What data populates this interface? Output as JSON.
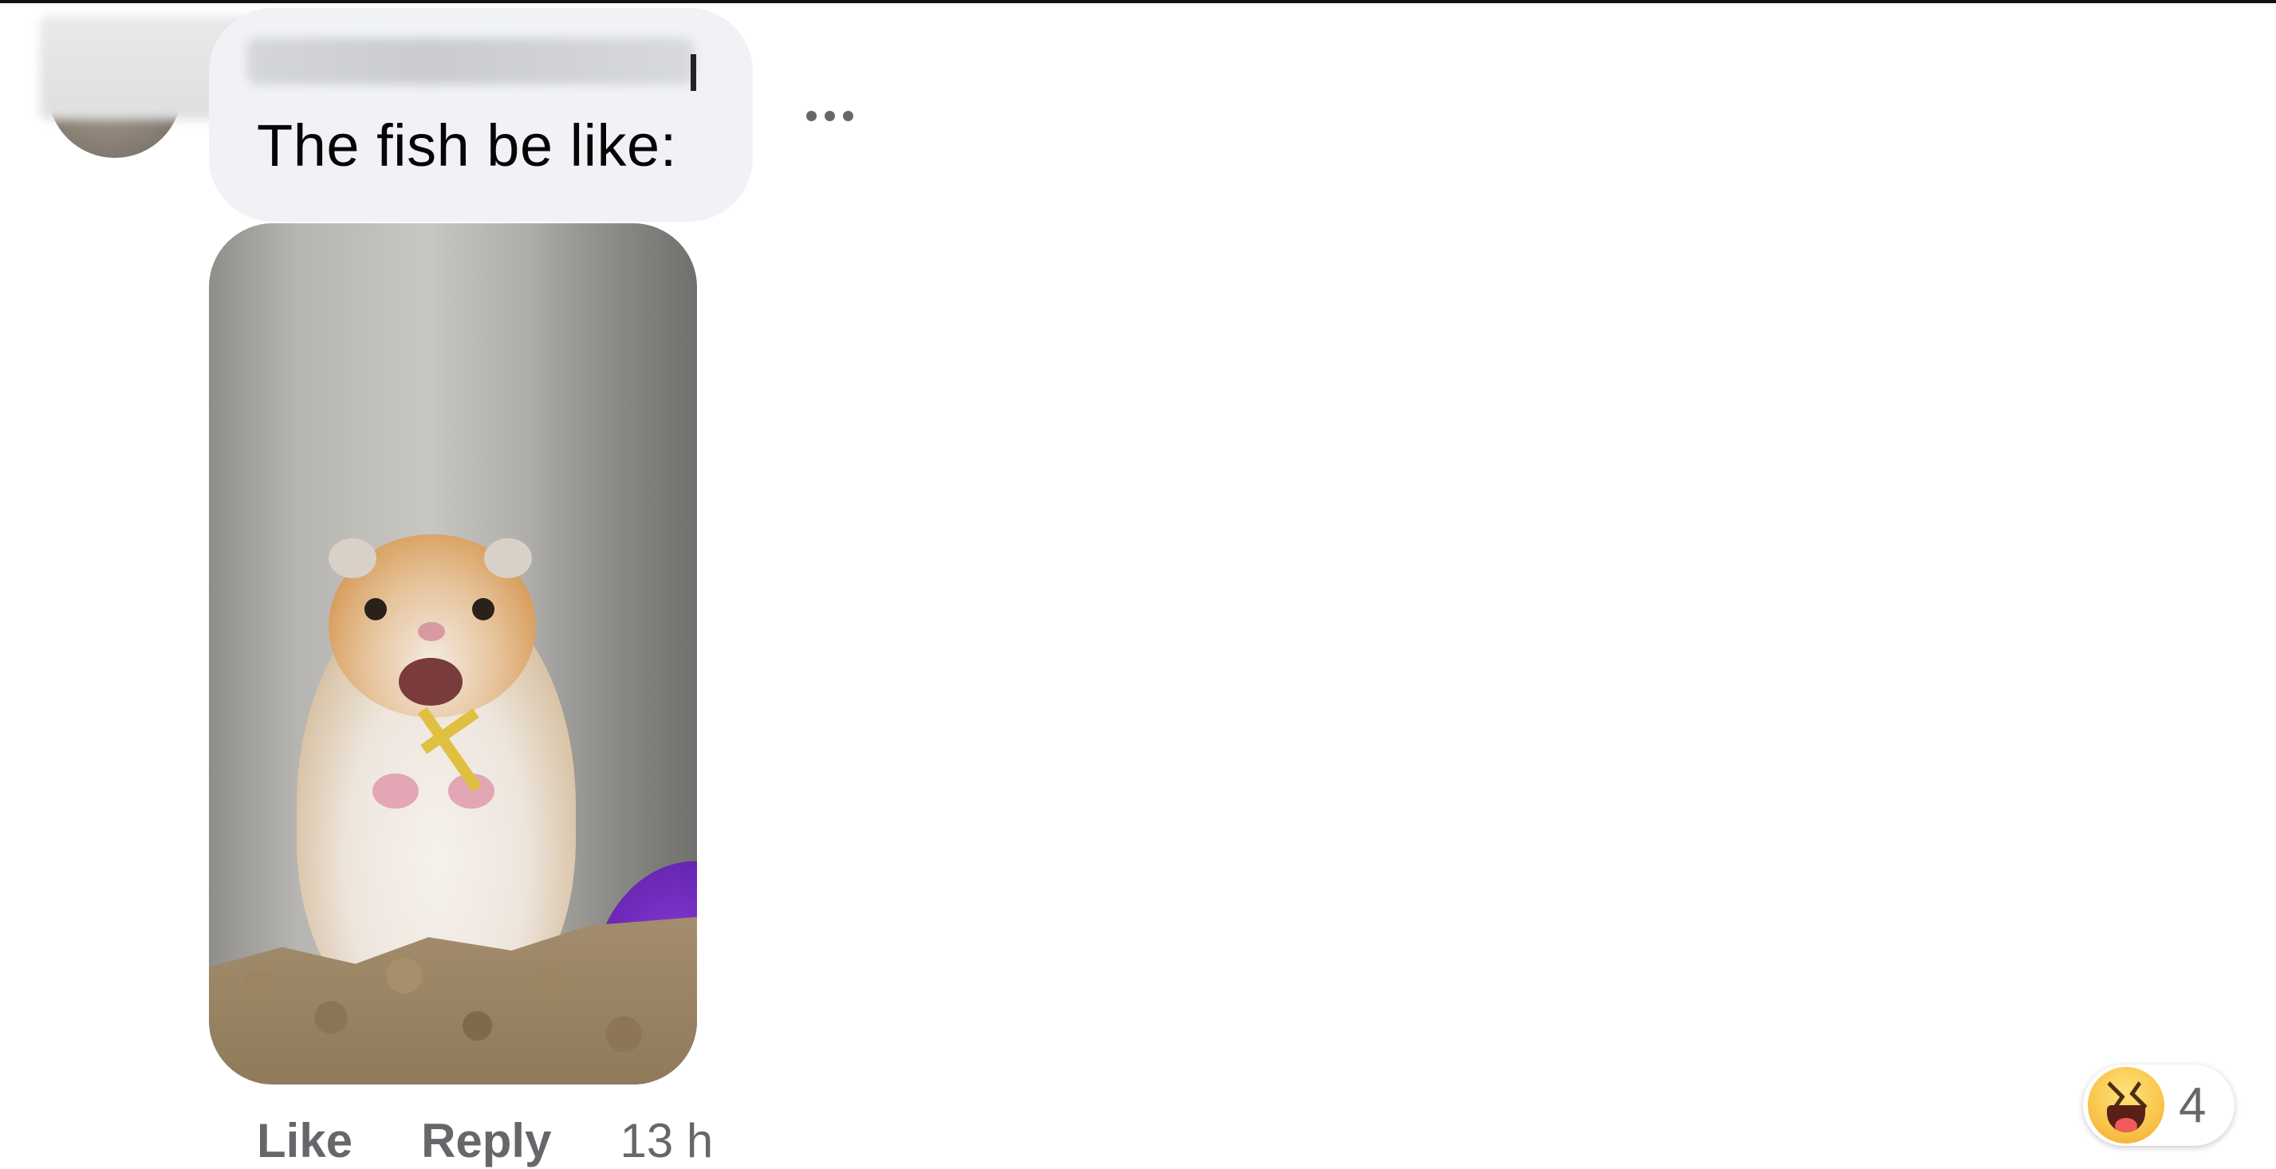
{
  "comment": {
    "text": "The fish be like:",
    "more_options_icon": "more-horizontal-icon",
    "photo_alt": "scared hamster holding a cross",
    "actions": {
      "like_label": "Like",
      "reply_label": "Reply",
      "timestamp": "13 h"
    },
    "reaction": {
      "icon": "laugh-emoji-icon",
      "count": "4"
    }
  },
  "colors": {
    "bubble": "#f0f2f5",
    "secondary_text": "#65676b",
    "primary_text": "#050505"
  }
}
